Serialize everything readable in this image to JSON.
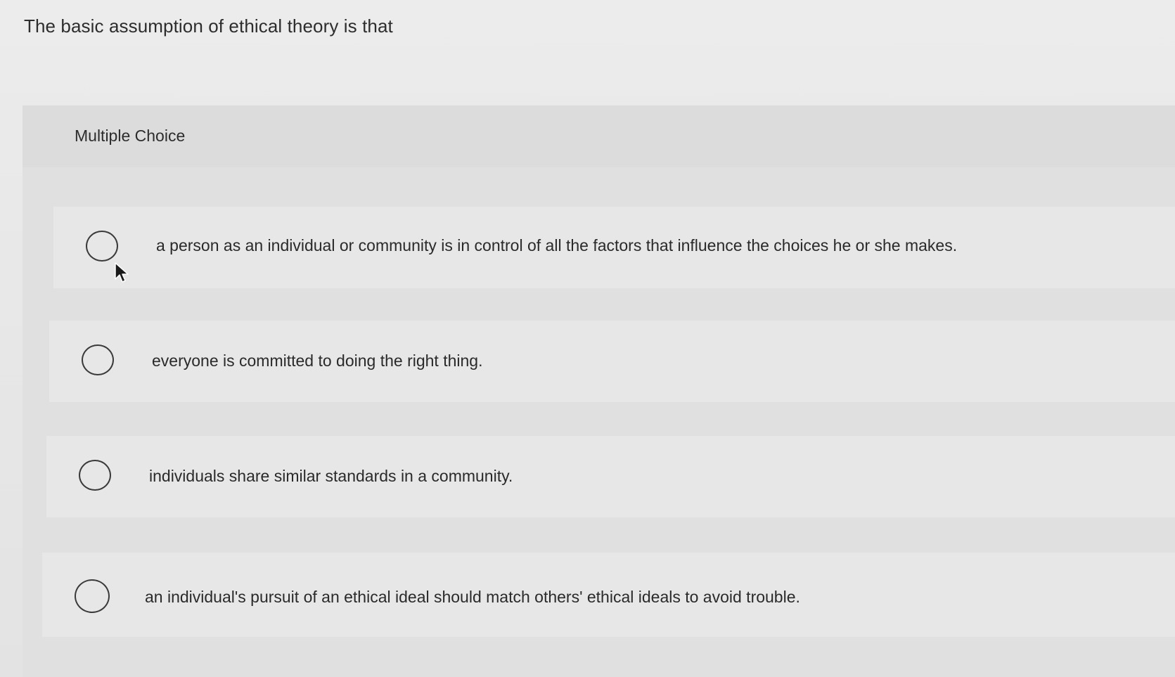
{
  "question": {
    "stem": "The basic assumption of ethical theory is that"
  },
  "multiple_choice": {
    "label": "Multiple Choice",
    "options": [
      {
        "text": "a person as an individual or community is in control of all the factors that influence the choices he or she makes."
      },
      {
        "text": "everyone is committed to doing the right thing."
      },
      {
        "text": "individuals share similar standards in a community."
      },
      {
        "text": "an individual's pursuit of an ethical ideal should match others' ethical ideals to avoid trouble."
      }
    ]
  },
  "icons": {
    "cursor": "mouse-pointer-icon",
    "radio": "radio-unchecked-icon"
  }
}
